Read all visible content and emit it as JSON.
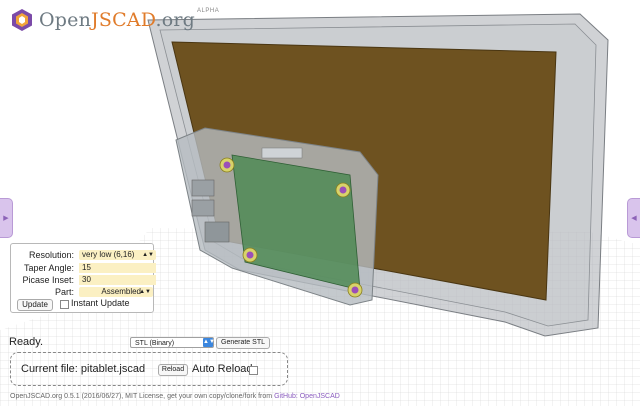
{
  "app": {
    "logo_prefix": "Open",
    "logo_accent": "JSCAD",
    "logo_suffix": ".org",
    "alpha": "ALPHA"
  },
  "colors": {
    "accent_orange": "#e07b2a",
    "panel_purple": "#d9c4ec",
    "field_bg": "#fbf0c3",
    "link": "#8b5dbf"
  },
  "parameters": {
    "resolution": {
      "label": "Resolution:",
      "value": "very low (6,16)"
    },
    "taper_angle": {
      "label": "Taper Angle:",
      "value": "15"
    },
    "picase_inset": {
      "label": "Picase Inset:",
      "value": "30"
    },
    "part": {
      "label": "Part:",
      "value": "Assembled"
    },
    "update_button": "Update",
    "instant_update_label": "Instant Update"
  },
  "status": {
    "text": "Ready.",
    "format_value": "STL (Binary)",
    "generate_button": "Generate STL"
  },
  "file": {
    "current_file_label": "Current file: pitablet.jscad",
    "reload_button": "Reload",
    "auto_reload_label": "Auto Reload"
  },
  "footer": {
    "text": "OpenJSCAD.org 0.5.1 (2016/06/27), MIT License, get your own copy/clone/fork from ",
    "link": "GitHub: OpenJSCAD"
  }
}
